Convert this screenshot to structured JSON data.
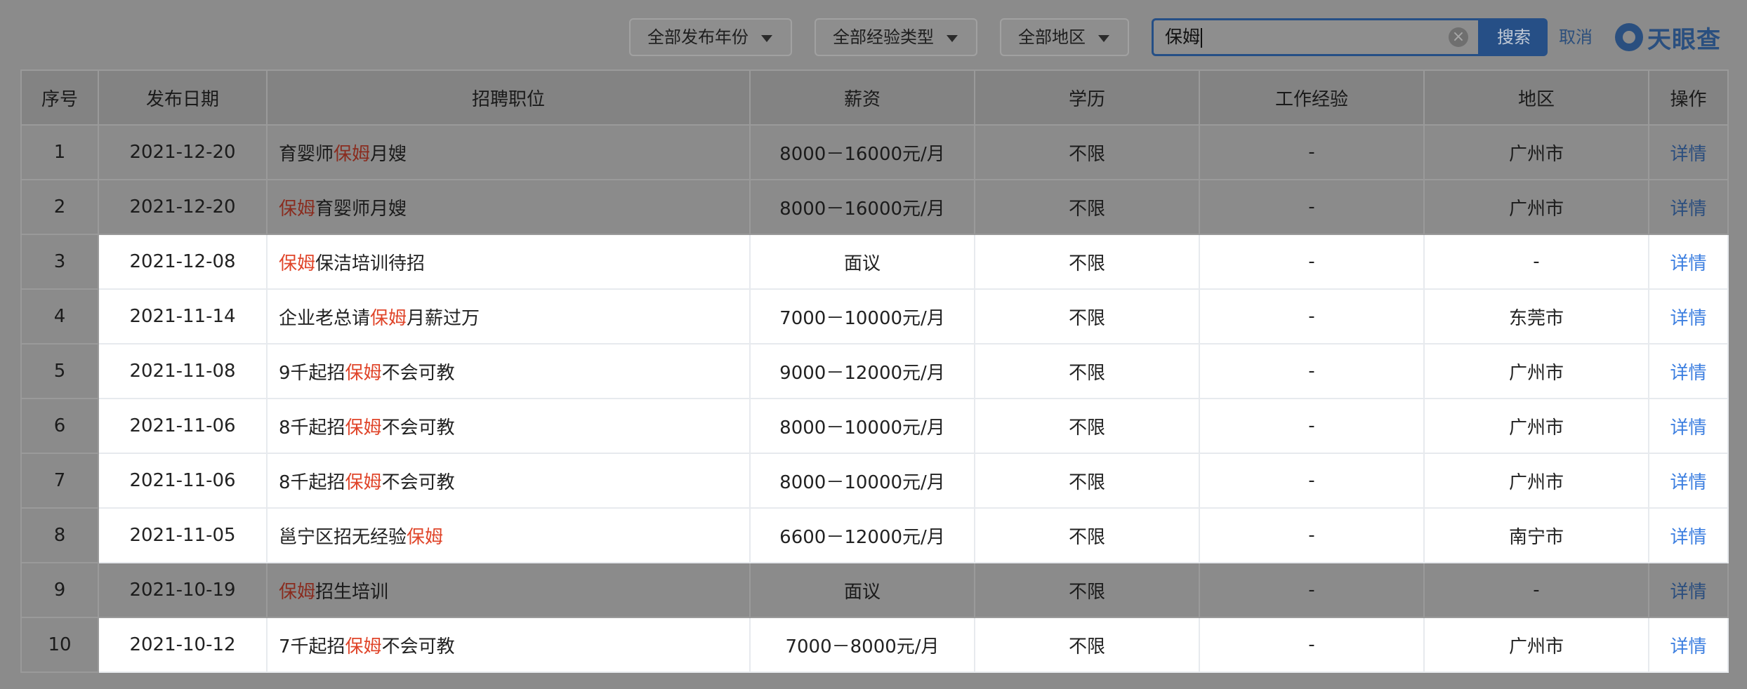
{
  "filters": {
    "year": "全部发布年份",
    "experience": "全部经验类型",
    "region": "全部地区"
  },
  "search": {
    "value": "保姆",
    "button": "搜索",
    "cancel": "取消"
  },
  "brand": {
    "name": "天眼查"
  },
  "table": {
    "headers": [
      "序号",
      "发布日期",
      "招聘职位",
      "薪资",
      "学历",
      "工作经验",
      "地区",
      "操作"
    ],
    "keyword": "保姆",
    "rows": [
      {
        "no": "1",
        "date": "2021-12-20",
        "title": [
          "育婴师",
          "保姆",
          "月嫂"
        ],
        "salary": "8000－16000元/月",
        "edu": "不限",
        "exp": "-",
        "region": "广州市",
        "action": "详情",
        "highlighted": false
      },
      {
        "no": "2",
        "date": "2021-12-20",
        "title": [
          "",
          "保姆",
          "育婴师月嫂"
        ],
        "salary": "8000－16000元/月",
        "edu": "不限",
        "exp": "-",
        "region": "广州市",
        "action": "详情",
        "highlighted": false
      },
      {
        "no": "3",
        "date": "2021-12-08",
        "title": [
          "",
          "保姆",
          "保洁培训待招"
        ],
        "salary": "面议",
        "edu": "不限",
        "exp": "-",
        "region": "-",
        "action": "详情",
        "highlighted": true
      },
      {
        "no": "4",
        "date": "2021-11-14",
        "title": [
          "企业老总请",
          "保姆",
          "月薪过万"
        ],
        "salary": "7000－10000元/月",
        "edu": "不限",
        "exp": "-",
        "region": "东莞市",
        "action": "详情",
        "highlighted": true
      },
      {
        "no": "5",
        "date": "2021-11-08",
        "title": [
          "9千起招",
          "保姆",
          "不会可教"
        ],
        "salary": "9000－12000元/月",
        "edu": "不限",
        "exp": "-",
        "region": "广州市",
        "action": "详情",
        "highlighted": true
      },
      {
        "no": "6",
        "date": "2021-11-06",
        "title": [
          "8千起招",
          "保姆",
          "不会可教"
        ],
        "salary": "8000－10000元/月",
        "edu": "不限",
        "exp": "-",
        "region": "广州市",
        "action": "详情",
        "highlighted": true
      },
      {
        "no": "7",
        "date": "2021-11-06",
        "title": [
          "8千起招",
          "保姆",
          "不会可教"
        ],
        "salary": "8000－10000元/月",
        "edu": "不限",
        "exp": "-",
        "region": "广州市",
        "action": "详情",
        "highlighted": true
      },
      {
        "no": "8",
        "date": "2021-11-05",
        "title": [
          "邕宁区招无经验",
          "保姆",
          ""
        ],
        "salary": "6600－12000元/月",
        "edu": "不限",
        "exp": "-",
        "region": "南宁市",
        "action": "详情",
        "highlighted": true
      },
      {
        "no": "9",
        "date": "2021-10-19",
        "title": [
          "",
          "保姆",
          "招生培训"
        ],
        "salary": "面议",
        "edu": "不限",
        "exp": "-",
        "region": "-",
        "action": "详情",
        "highlighted": false
      },
      {
        "no": "10",
        "date": "2021-10-12",
        "title": [
          "7千起招",
          "保姆",
          "不会可教"
        ],
        "salary": "7000－8000元/月",
        "edu": "不限",
        "exp": "-",
        "region": "广州市",
        "action": "详情",
        "highlighted": true
      }
    ]
  }
}
